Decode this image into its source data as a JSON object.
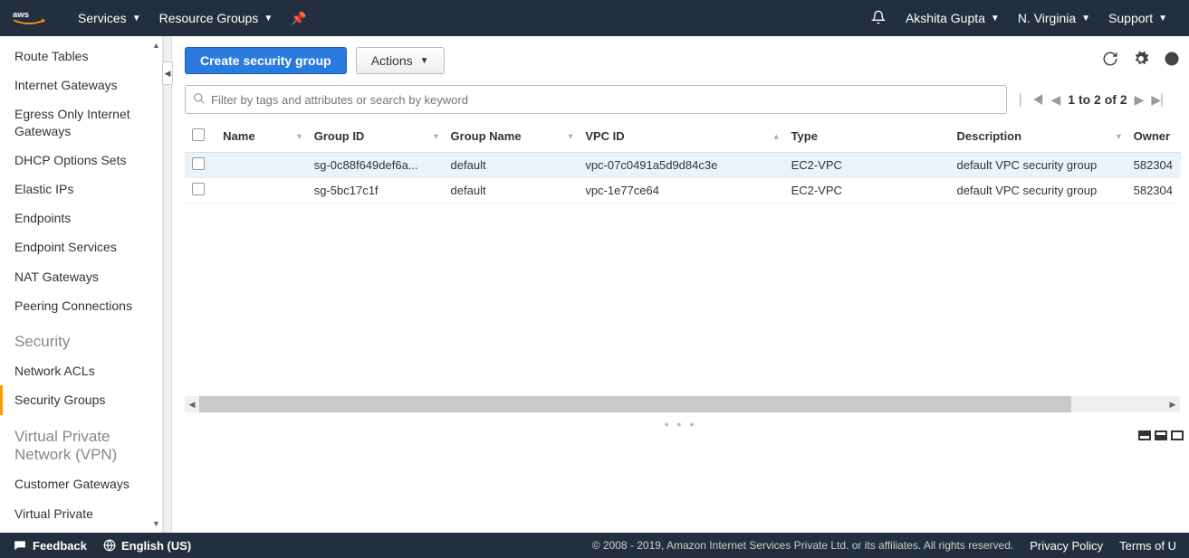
{
  "topnav": {
    "services": "Services",
    "resource_groups": "Resource Groups",
    "user": "Akshita Gupta",
    "region": "N. Virginia",
    "support": "Support"
  },
  "sidebar": {
    "items_top": [
      "Route Tables",
      "Internet Gateways",
      "Egress Only Internet Gateways",
      "DHCP Options Sets",
      "Elastic IPs",
      "Endpoints",
      "Endpoint Services",
      "NAT Gateways",
      "Peering Connections"
    ],
    "heading_security": "Security",
    "items_security": [
      "Network ACLs",
      "Security Groups"
    ],
    "selected": "Security Groups",
    "heading_vpn": "Virtual Private Network (VPN)",
    "items_vpn": [
      "Customer Gateways",
      "Virtual Private"
    ]
  },
  "toolbar": {
    "create": "Create security group",
    "actions": "Actions"
  },
  "search": {
    "placeholder": "Filter by tags and attributes or search by keyword"
  },
  "pager": {
    "text": "1 to 2 of 2"
  },
  "table": {
    "headers": [
      "Name",
      "Group ID",
      "Group Name",
      "VPC ID",
      "Type",
      "Description",
      "Owner"
    ],
    "rows": [
      {
        "name": "",
        "group_id": "sg-0c88f649def6a...",
        "group_name": "default",
        "vpc_id": "vpc-07c0491a5d9d84c3e",
        "type": "EC2-VPC",
        "description": "default VPC security group",
        "owner": "582304"
      },
      {
        "name": "",
        "group_id": "sg-5bc17c1f",
        "group_name": "default",
        "vpc_id": "vpc-1e77ce64",
        "type": "EC2-VPC",
        "description": "default VPC security group",
        "owner": "582304"
      }
    ]
  },
  "footer": {
    "feedback": "Feedback",
    "language": "English (US)",
    "copyright": "© 2008 - 2019, Amazon Internet Services Private Ltd. or its affiliates. All rights reserved.",
    "privacy": "Privacy Policy",
    "terms": "Terms of U"
  }
}
